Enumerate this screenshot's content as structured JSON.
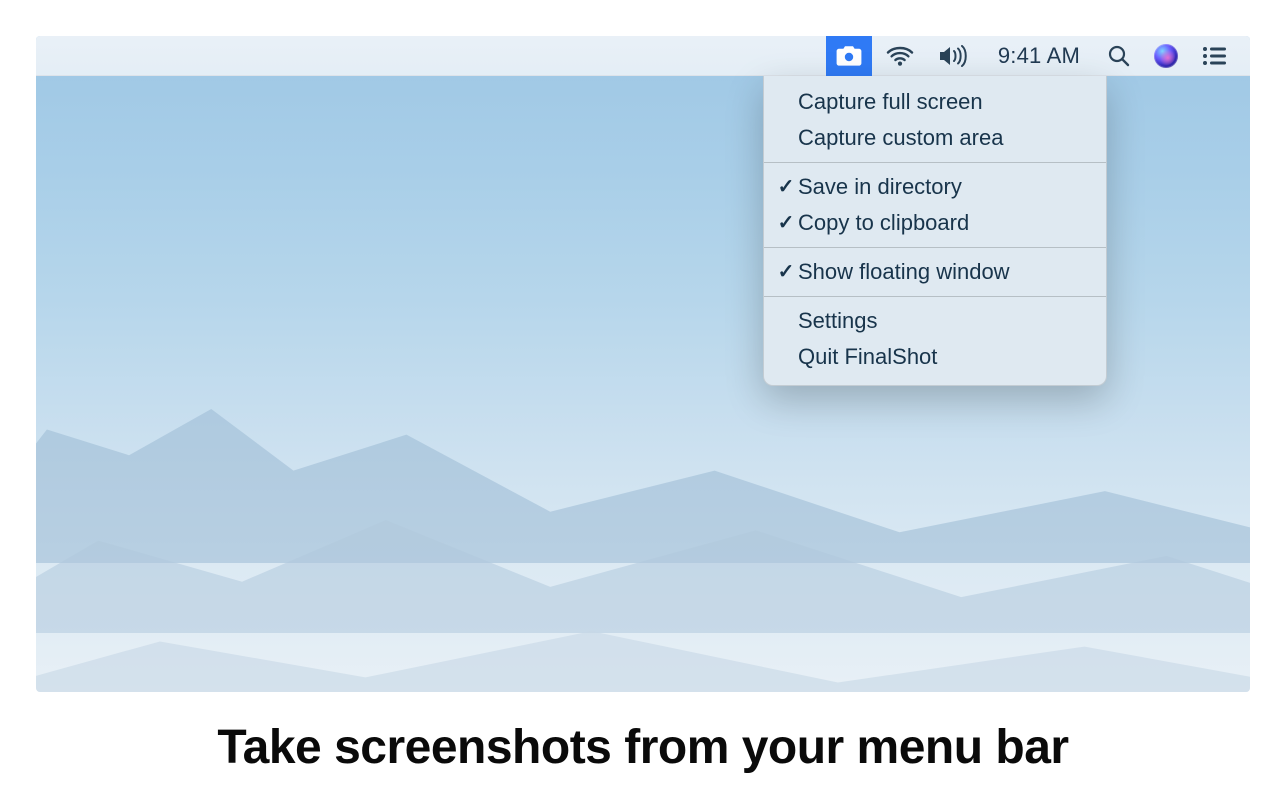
{
  "menubar": {
    "time": "9:41 AM",
    "icons": {
      "app": "camera-icon",
      "wifi": "wifi-icon",
      "volume": "volume-icon",
      "spotlight": "search-icon",
      "siri": "siri-icon",
      "notifications": "list-icon"
    },
    "app_selected": true
  },
  "dropdown": {
    "groups": [
      [
        {
          "label": "Capture full screen",
          "checked": false
        },
        {
          "label": "Capture custom area",
          "checked": false
        }
      ],
      [
        {
          "label": "Save in directory",
          "checked": true
        },
        {
          "label": "Copy to clipboard",
          "checked": true
        }
      ],
      [
        {
          "label": "Show floating window",
          "checked": true
        }
      ],
      [
        {
          "label": "Settings",
          "checked": false
        },
        {
          "label": "Quit FinalShot",
          "checked": false
        }
      ]
    ]
  },
  "caption": "Take screenshots from your menu bar",
  "colors": {
    "accent": "#2f7af5",
    "menubar_bg": "#e7eff6",
    "dropdown_bg": "#dfe9f1",
    "text": "#18344b"
  }
}
